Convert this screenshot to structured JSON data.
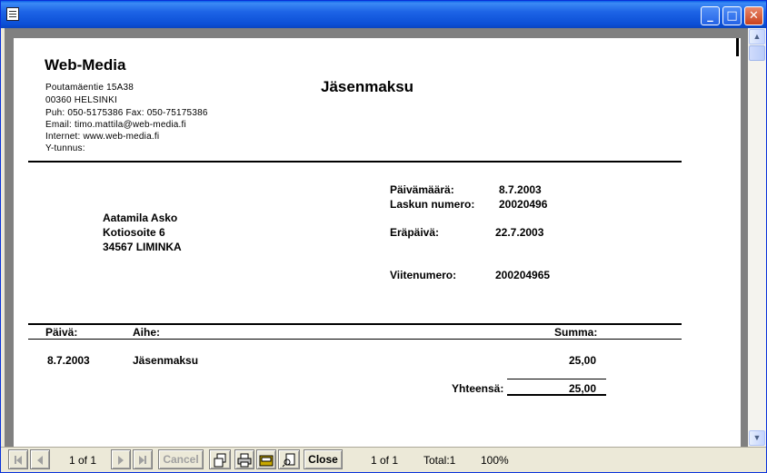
{
  "company": {
    "name": "Web-Media",
    "address1": "Poutamäentie 15A38",
    "address2": "00360 HELSINKI",
    "phone_fax": "Puh: 050-5175386  Fax: 050-75175386",
    "email": "Email: timo.mattila@web-media.fi",
    "internet": "Internet: www.web-media.fi",
    "ytunnus": "Y-tunnus:"
  },
  "document_title": "Jäsenmaksu",
  "recipient": {
    "name": "Aatamila Asko",
    "street": "Kotiosoite 6",
    "city": "34567 LIMINKA"
  },
  "details": [
    {
      "label": "Päivämäärä:",
      "value": "8.7.2003"
    },
    {
      "label": "Laskun numero:",
      "value": "20020496"
    },
    {
      "label": "Eräpäivä:",
      "value": "22.7.2003"
    },
    {
      "label": "Viitenumero:",
      "value": "200204965"
    }
  ],
  "table": {
    "headers": {
      "date": "Päivä:",
      "subject": "Aihe:",
      "sum": "Summa:"
    },
    "rows": [
      {
        "date": "8.7.2003",
        "subject": "Jäsenmaksu",
        "sum": "25,00"
      }
    ],
    "total_label": "Yhteensä:",
    "total_value": "25,00"
  },
  "toolbar": {
    "page_indicator": "1 of 1",
    "cancel_label": "Cancel",
    "close_label": "Close",
    "page_status": "1 of 1",
    "total_status": "Total:1",
    "zoom_status": "100%"
  },
  "titlebar_buttons": {
    "minimize": "_",
    "maximize": "□",
    "close": "✕"
  },
  "icons": [
    "app-icon",
    "first-page-icon",
    "prev-page-icon",
    "next-page-icon",
    "last-page-icon",
    "multi-page-icon",
    "print-icon",
    "export-icon",
    "search-icon"
  ]
}
